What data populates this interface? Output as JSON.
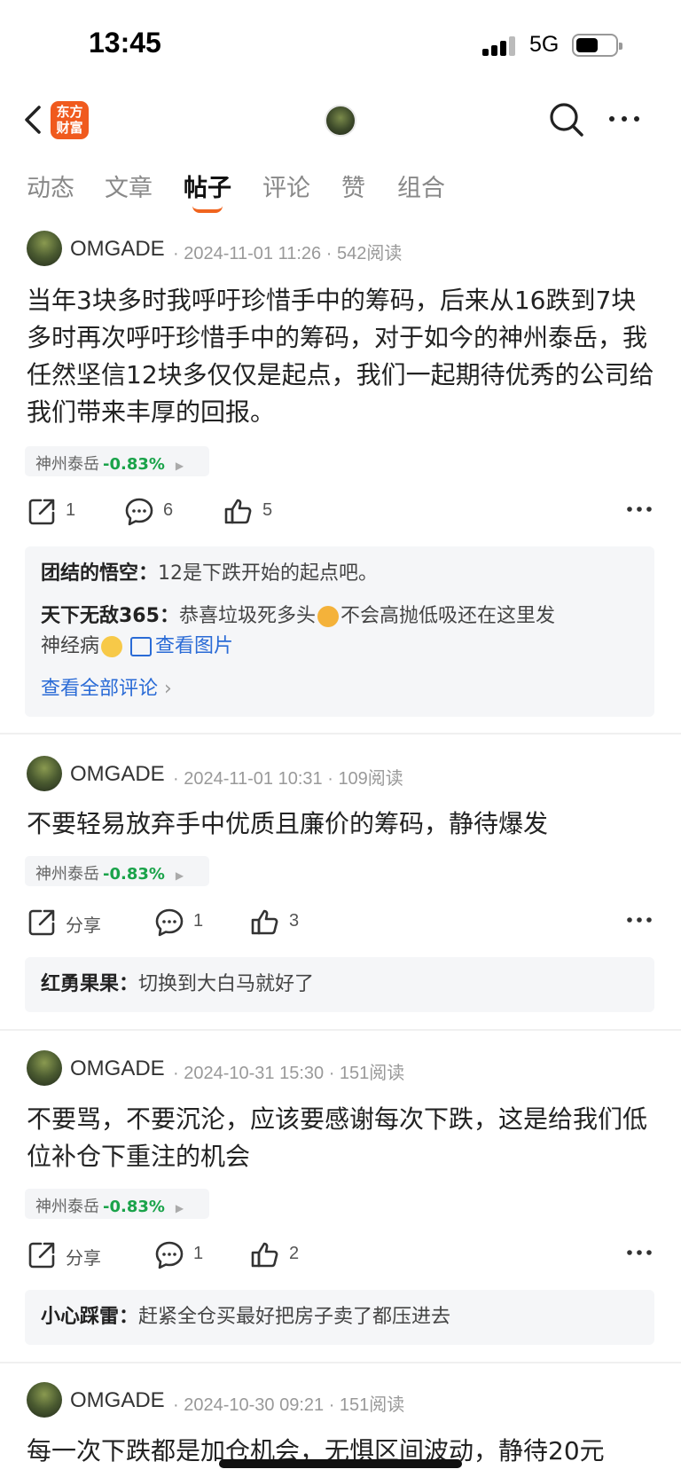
{
  "status_bar": {
    "time": "13:45",
    "network": "5G"
  },
  "nav": {
    "logo_line1": "东方",
    "logo_line2": "财富"
  },
  "tabs": [
    "动态",
    "文章",
    "帖子",
    "评论",
    "赞",
    "组合"
  ],
  "posts": [
    {
      "author": "OMGADE",
      "datetime": "2024-11-01 11:26",
      "reads": "542阅读",
      "body": "当年3块多时我呼吁珍惜手中的筹码，后来从16跌到7块多时再次呼吁珍惜手中的筹码，对于如今的神州泰岳，我任然坚信12块多仅仅是起点，我们一起期待优秀的公司给我们带来丰厚的回报。",
      "stock_name": "神州泰岳",
      "stock_change": "-0.83%",
      "share": "1",
      "comment_count": "6",
      "like_count": "5",
      "comments": [
        {
          "user": "团结的悟空",
          "text": "12是下跌开始的起点吧。"
        },
        {
          "user": "天下无敌365",
          "text": "恭喜垃圾死多头",
          "text2": "不会高抛低吸还在这里发",
          "text3": "神经病",
          "view_image": "查看图片"
        }
      ],
      "view_all": "查看全部评论"
    },
    {
      "author": "OMGADE",
      "datetime": "2024-11-01 10:31",
      "reads": "109阅读",
      "body": "不要轻易放弃手中优质且廉价的筹码，静待爆发",
      "stock_name": "神州泰岳",
      "stock_change": "-0.83%",
      "share": "分享",
      "comment_count": "1",
      "like_count": "3",
      "comments": [
        {
          "user": "红勇果果",
          "text": "切换到大白马就好了"
        }
      ]
    },
    {
      "author": "OMGADE",
      "datetime": "2024-10-31 15:30",
      "reads": "151阅读",
      "body": "不要骂，不要沉沦，应该要感谢每次下跌，这是给我们低位补仓下重注的机会",
      "stock_name": "神州泰岳",
      "stock_change": "-0.83%",
      "share": "分享",
      "comment_count": "1",
      "like_count": "2",
      "comments": [
        {
          "user": "小心踩雷",
          "text": "赶紧全仓买最好把房子卖了都压进去"
        }
      ]
    },
    {
      "author": "OMGADE",
      "datetime": "2024-10-30 09:21",
      "reads": "151阅读",
      "body": "每一次下跌都是加仓机会，无惧区间波动，静待20元"
    }
  ]
}
